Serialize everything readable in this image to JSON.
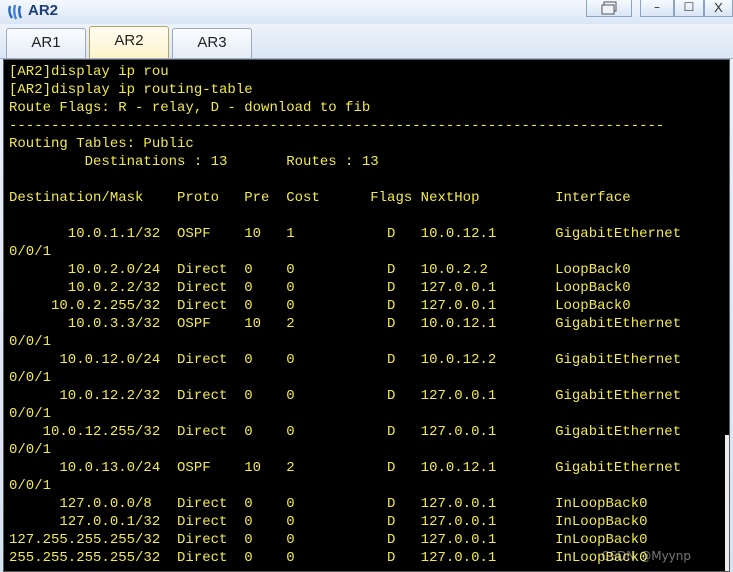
{
  "window": {
    "title": "AR2",
    "icon": "huawei-router-icon",
    "buttons": {
      "restore_label": "",
      "minimize_label": "–",
      "maximize_label": "☐",
      "close_label": "X"
    }
  },
  "tabs": [
    {
      "label": "AR1",
      "active": false
    },
    {
      "label": "AR2",
      "active": true
    },
    {
      "label": "AR3",
      "active": false
    }
  ],
  "terminal": {
    "lines": [
      "[AR2]display ip rou",
      "[AR2]display ip routing-table",
      "Route Flags: R - relay, D - download to fib",
      "------------------------------------------------------------------------------",
      "Routing Tables: Public",
      "         Destinations : 13       Routes : 13",
      "",
      "Destination/Mask    Proto   Pre  Cost      Flags NextHop         Interface",
      "",
      "       10.0.1.1/32  OSPF    10   1           D   10.0.12.1       GigabitEthernet",
      "0/0/1",
      "       10.0.2.0/24  Direct  0    0           D   10.0.2.2        LoopBack0",
      "       10.0.2.2/32  Direct  0    0           D   127.0.0.1       LoopBack0",
      "     10.0.2.255/32  Direct  0    0           D   127.0.0.1       LoopBack0",
      "       10.0.3.3/32  OSPF    10   2           D   10.0.12.1       GigabitEthernet",
      "0/0/1",
      "      10.0.12.0/24  Direct  0    0           D   10.0.12.2       GigabitEthernet",
      "0/0/1",
      "      10.0.12.2/32  Direct  0    0           D   127.0.0.1       GigabitEthernet",
      "0/0/1",
      "    10.0.12.255/32  Direct  0    0           D   127.0.0.1       GigabitEthernet",
      "0/0/1",
      "      10.0.13.0/24  OSPF    10   2           D   10.0.12.1       GigabitEthernet",
      "0/0/1",
      "      127.0.0.0/8   Direct  0    0           D   127.0.0.1       InLoopBack0",
      "      127.0.0.1/32  Direct  0    0           D   127.0.0.1       InLoopBack0",
      "127.255.255.255/32  Direct  0    0           D   127.0.0.1       InLoopBack0",
      "255.255.255.255/32  Direct  0    0           D   127.0.0.1       InLoopBack0"
    ]
  },
  "watermark": "CSDN @Myynp",
  "colors": {
    "terminal_bg": "#000000",
    "terminal_fg": "#f2ea47",
    "title_fg": "#1e3e78",
    "active_tab_bg": "#fdf3cc"
  }
}
